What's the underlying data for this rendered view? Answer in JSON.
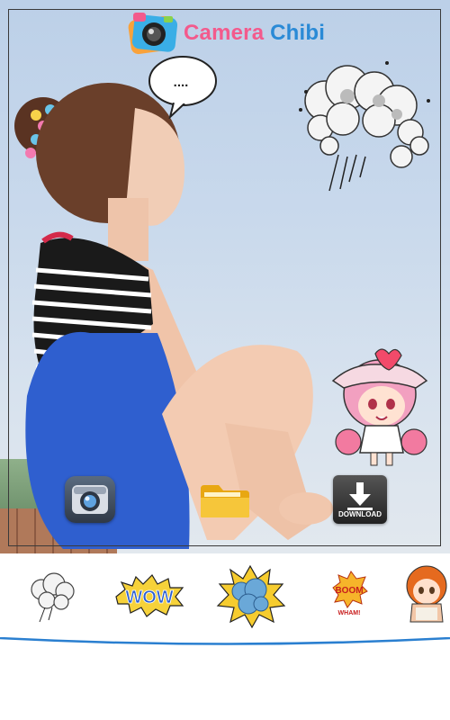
{
  "app": {
    "title_part1": "Camera",
    "title_part2": "Chibi"
  },
  "photo": {
    "speech_bubble_text": "....",
    "stickers": [
      "storm-cloud-sticker",
      "chibi-cheerleader-sticker"
    ]
  },
  "controls": {
    "camera": {
      "icon": "camera-icon"
    },
    "open": {
      "icon": "folder-icon"
    },
    "download": {
      "icon": "download-icon",
      "label": "DOWNLOAD"
    }
  },
  "sticker_strip": {
    "items": [
      {
        "icon": "smoke-cloud-sticker"
      },
      {
        "icon": "wow-text-sticker",
        "text": "WOW"
      },
      {
        "icon": "explosion-sticker"
      },
      {
        "icon": "boom-sticker",
        "text": "BOOM",
        "subtext": "WHAM!"
      },
      {
        "icon": "chibi-girl-sticker"
      }
    ]
  },
  "colors": {
    "brand_pink": "#f35a8c",
    "brand_blue": "#2a8ad6",
    "strip_line": "#2a7fd0"
  }
}
